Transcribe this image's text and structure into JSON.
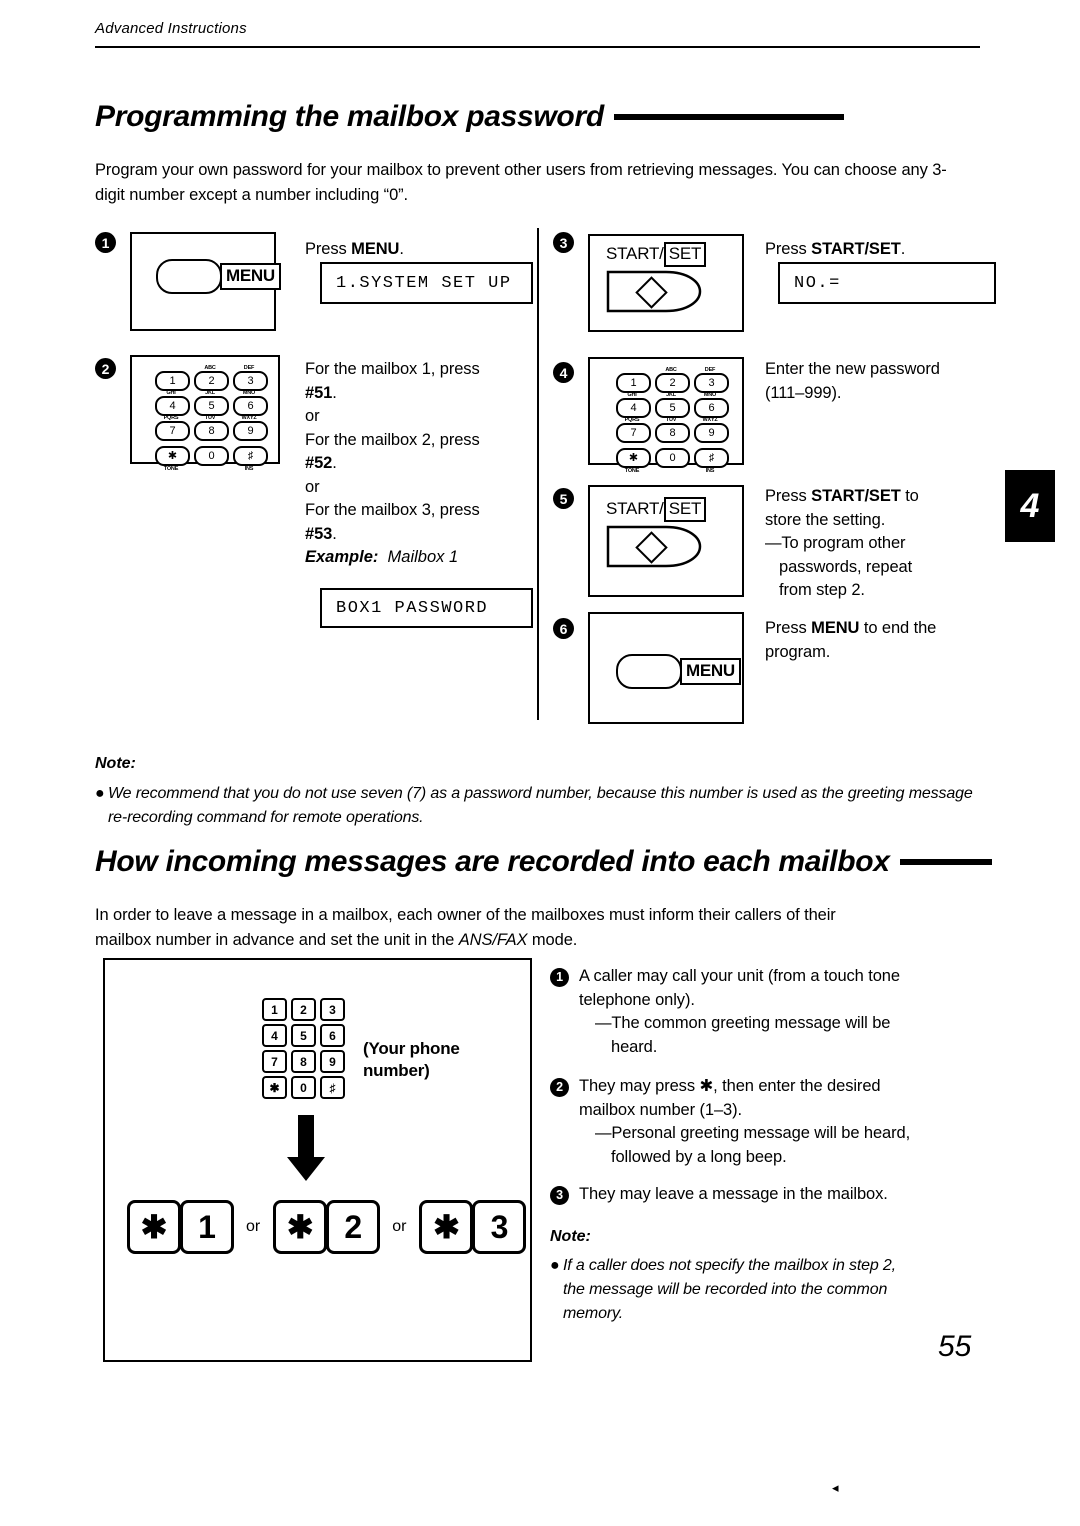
{
  "running_head": "Advanced Instructions",
  "chapter_tab": "4",
  "page_number": "55",
  "foot_mark": "◂",
  "section1": {
    "heading": "Programming the mailbox password",
    "intro": "Program your own password for your mailbox to prevent other users from retrieving messages. You can choose any 3-digit number except a number including “0”.",
    "steps": [
      {
        "num": "1",
        "illustration": "menu-button",
        "text_before": "Press ",
        "text_bold": "MENU",
        "text_after": ".",
        "lcd": "1.SYSTEM SET UP"
      },
      {
        "num": "2",
        "illustration": "dial-keypad",
        "line1": "For the mailbox 1, press",
        "code1": "#51",
        "or1": "or",
        "line2": "For the mailbox 2, press",
        "code2": "#52",
        "or2": "or",
        "line3": "For the mailbox 3, press",
        "code3": "#53",
        "example_label": "Example:",
        "example_value": "Mailbox 1",
        "lcd": "BOX1 PASSWORD"
      },
      {
        "num": "3",
        "illustration": "start-set-button",
        "text_before": "Press ",
        "text_bold": "START/SET",
        "text_after": ".",
        "lcd": "NO.="
      },
      {
        "num": "4",
        "illustration": "dial-keypad",
        "line1": "Enter the new password",
        "line2": "(111–999)."
      },
      {
        "num": "5",
        "illustration": "start-set-button",
        "text_before": "Press ",
        "text_bold": "START/SET",
        "text_after": " to",
        "line2": "store the setting.",
        "dash_line1": "—To program other",
        "dash_line2": "passwords, repeat",
        "dash_line3": "from step 2."
      },
      {
        "num": "6",
        "illustration": "menu-button",
        "text_before": "Press ",
        "text_bold": "MENU",
        "text_after": " to end the",
        "line2": "program."
      }
    ],
    "note_heading": "Note:",
    "note_bullet": "●",
    "note_text": "We recommend that you do not use seven (7) as a password number, because this number is used as the greeting message re-recording command for remote operations."
  },
  "section2": {
    "heading": "How incoming messages are recorded into each mailbox",
    "intro_line1": "In order to leave a message in a mailbox, each owner of the mailboxes must inform their callers of their",
    "intro_line2_a": "mailbox number in advance and set the unit in the ",
    "intro_line2_italic": "ANS/FAX",
    "intro_line2_b": " mode.",
    "figure": {
      "keypad_rows": [
        [
          "1",
          "2",
          "3"
        ],
        [
          "4",
          "5",
          "6"
        ],
        [
          "7",
          "8",
          "9"
        ],
        [
          "✱",
          "0",
          "♯"
        ]
      ],
      "caption_line1": "(Your phone",
      "caption_line2": "number)",
      "arrow": "↓",
      "options": [
        {
          "star": "✱",
          "digit": "1"
        },
        {
          "star": "✱",
          "digit": "2"
        },
        {
          "star": "✱",
          "digit": "3"
        }
      ],
      "or_label": "or"
    },
    "list": [
      {
        "num": "1",
        "line1": "A caller may call your unit (from a touch tone",
        "line2": "telephone only).",
        "sub1": "—The common greeting message will be",
        "sub2": "heard."
      },
      {
        "num": "2",
        "line1": "They may press ✱, then enter the desired",
        "line2": "mailbox number (1–3).",
        "sub1": "—Personal greeting message will be heard,",
        "sub2": "followed by a long beep."
      },
      {
        "num": "3",
        "line1": "They may leave a message in the mailbox."
      }
    ],
    "note_heading": "Note:",
    "note_bullet": "●",
    "note_line1": "If a caller does not specify the mailbox in step 2,",
    "note_line2": "the message will be recorded into the common",
    "note_line3": "memory."
  },
  "keypad_legend": {
    "sup": [
      "",
      "ABC",
      "DEF",
      "GHI",
      "JKL",
      "MNO",
      "PQRS",
      "TUV",
      "WXYZ",
      "",
      "",
      ""
    ],
    "star_sub": "TONE",
    "hash_sub": "INS"
  }
}
